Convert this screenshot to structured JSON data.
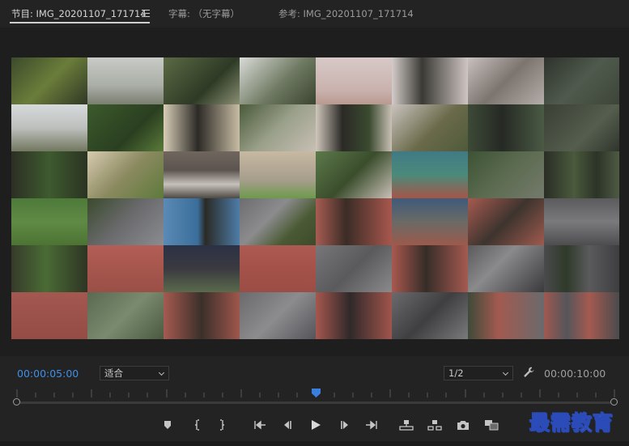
{
  "tabs": [
    {
      "label": "节目: IMG_20201107_171714",
      "active": true
    },
    {
      "label": "字幕: （无字幕）",
      "active": false
    },
    {
      "label": "参考: IMG_20201107_171714",
      "active": false
    }
  ],
  "controls": {
    "current_timecode": "00:00:05:00",
    "zoom_select": "适合",
    "resolution_select": "1/2",
    "duration_timecode": "00:00:10:00"
  },
  "playhead_fraction": 0.5,
  "transport_buttons": [
    "add-marker",
    "mark-in",
    "mark-out",
    "go-to-in",
    "step-back",
    "play",
    "step-forward",
    "go-to-out",
    "lift",
    "extract",
    "export-frame",
    "compare"
  ],
  "watermark": "最需教育",
  "colors": {
    "accent_timecode": "#3f8fe6",
    "playhead": "#3a7ede"
  }
}
